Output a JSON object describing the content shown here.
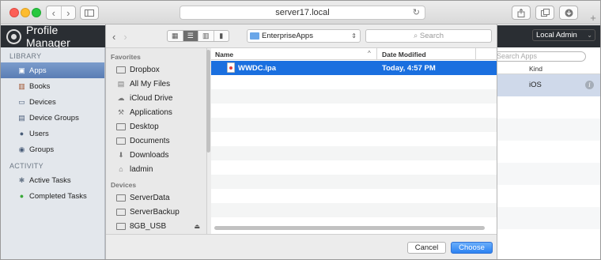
{
  "browser": {
    "address": "server17.local",
    "reload_icon": "reload-icon",
    "plus_label": "+"
  },
  "app": {
    "title": "Profile Manager",
    "user_menu": "Local Admin"
  },
  "sidebar": {
    "library_title": "LIBRARY",
    "activity_title": "ACTIVITY",
    "library_items": [
      {
        "label": "Apps",
        "icon": "apps-icon",
        "selected": true
      },
      {
        "label": "Books",
        "icon": "books-icon"
      },
      {
        "label": "Devices",
        "icon": "devices-icon"
      },
      {
        "label": "Device Groups",
        "icon": "device-groups-icon"
      },
      {
        "label": "Users",
        "icon": "user-icon"
      },
      {
        "label": "Groups",
        "icon": "groups-icon"
      }
    ],
    "activity_items": [
      {
        "label": "Active Tasks",
        "icon": "active-tasks-icon"
      },
      {
        "label": "Completed Tasks",
        "icon": "completed-tasks-icon"
      }
    ]
  },
  "apps_panel": {
    "search_placeholder": "Search Apps",
    "kind_header": "Kind",
    "kind_value": "iOS"
  },
  "dialog": {
    "location": "EnterpriseApps",
    "search_placeholder": "Search",
    "favorites_title": "Favorites",
    "devices_title": "Devices",
    "favorites": [
      {
        "label": "Dropbox",
        "icon": "folder-icon"
      },
      {
        "label": "All My Files",
        "icon": "all-files-icon"
      },
      {
        "label": "iCloud Drive",
        "icon": "cloud-icon"
      },
      {
        "label": "Applications",
        "icon": "applications-icon"
      },
      {
        "label": "Desktop",
        "icon": "desktop-icon"
      },
      {
        "label": "Documents",
        "icon": "documents-icon"
      },
      {
        "label": "Downloads",
        "icon": "downloads-icon"
      },
      {
        "label": "ladmin",
        "icon": "home-icon"
      }
    ],
    "devices": [
      {
        "label": "ServerData",
        "icon": "drive-icon"
      },
      {
        "label": "ServerBackup",
        "icon": "drive-icon"
      },
      {
        "label": "8GB_USB",
        "icon": "drive-icon",
        "ejectable": true
      }
    ],
    "columns": {
      "name": "Name",
      "date": "Date Modified"
    },
    "files": [
      {
        "name": "WWDC.ipa",
        "date": "Today, 4:57 PM",
        "selected": true
      }
    ],
    "cancel_label": "Cancel",
    "choose_label": "Choose"
  },
  "colors": {
    "accent": "#1a6fdf",
    "header_dark": "#2a2e33",
    "sidebar_bg": "#e3e7ec"
  }
}
